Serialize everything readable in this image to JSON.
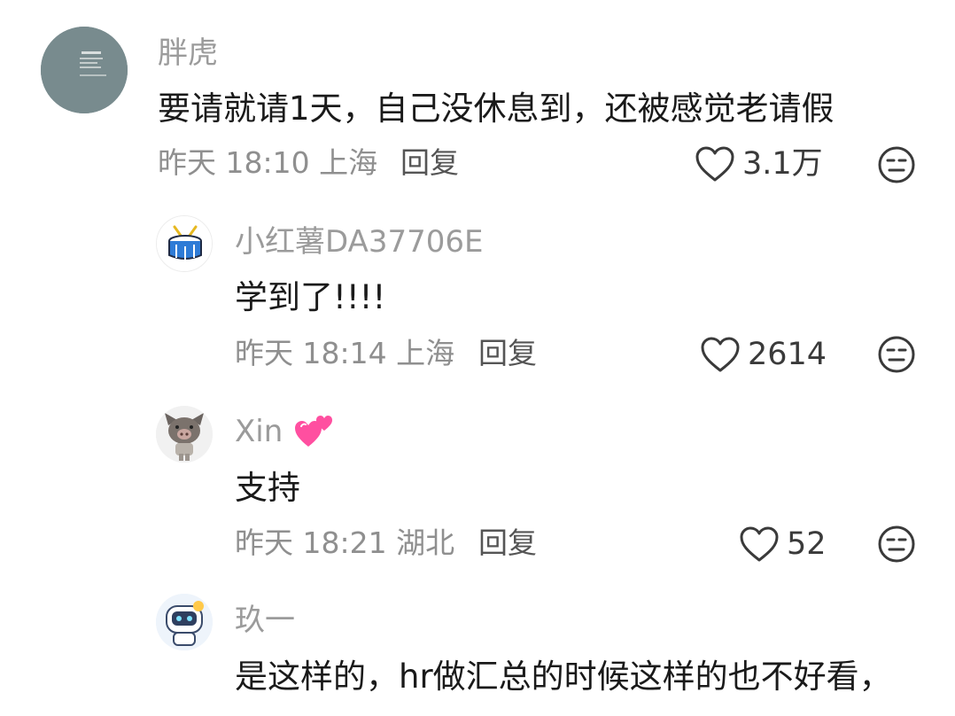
{
  "comments": [
    {
      "username": "胖虎",
      "text": "要请就请1天，自己没休息到，还被感觉老请假",
      "meta": "昨天 18:10 上海",
      "reply_label": "回复",
      "likes": "3.1万",
      "avatar": "photo-avatar"
    },
    {
      "username": "小红薯DA37706E",
      "text": "学到了!!!!",
      "meta": "昨天 18:14 上海",
      "reply_label": "回复",
      "likes": "2614",
      "avatar": "drum-avatar"
    },
    {
      "username": "Xin",
      "username_emoji": "two-hearts-icon",
      "text": "支持",
      "meta": "昨天 18:21 湖北",
      "reply_label": "回复",
      "likes": "52",
      "avatar": "boar-mask-avatar"
    },
    {
      "username": "玖一",
      "text": "是这样的，hr做汇总的时候这样的也不好看，",
      "avatar": "robot-avatar"
    }
  ],
  "colors": {
    "username": "#9b9b9b",
    "text": "#1a1a1a",
    "meta": "#8f8f8f",
    "accent_heart": "#ff4fa0"
  }
}
